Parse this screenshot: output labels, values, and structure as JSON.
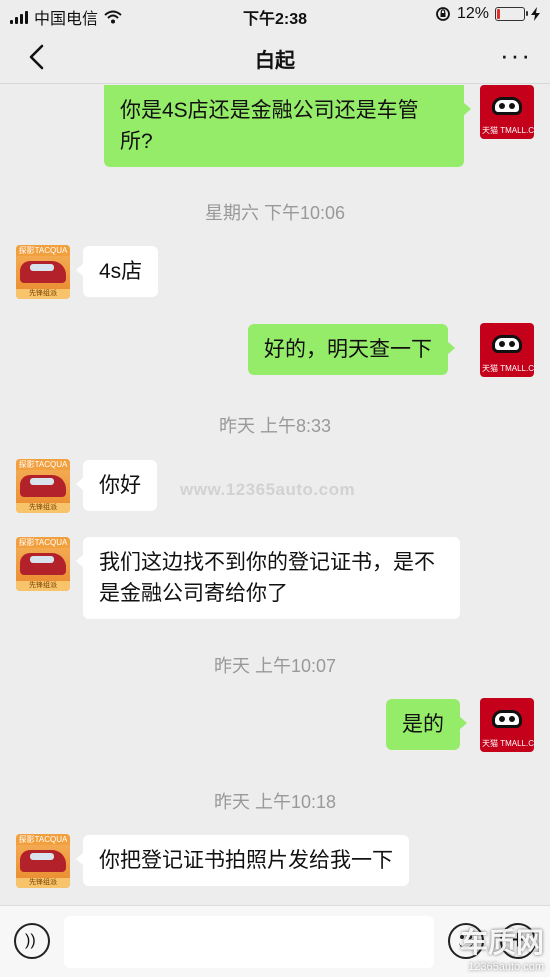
{
  "status_bar": {
    "carrier": "中国电信",
    "time": "下午2:38",
    "battery_percent": "12%",
    "battery_level": 0.12,
    "battery_color": "#e0302a"
  },
  "nav": {
    "title": "白起",
    "back_icon": "chevron-left-icon",
    "more_icon": "more-dots-icon",
    "more_glyph": "···"
  },
  "messages": [
    {
      "side": "sent",
      "text": "你是4S店还是金融公司还是车管所?",
      "avatar": "tmall"
    },
    {
      "divider": "星期六 下午10:06"
    },
    {
      "side": "recv",
      "text": "4s店",
      "avatar": "car"
    },
    {
      "side": "sent",
      "text": "好的，明天查一下",
      "avatar": "tmall"
    },
    {
      "divider": "昨天 上午8:33"
    },
    {
      "side": "recv",
      "text": "你好",
      "avatar": "car"
    },
    {
      "side": "recv",
      "text": "我们这边找不到你的登记证书，是不是金融公司寄给你了",
      "avatar": "car"
    },
    {
      "divider": "昨天 上午10:07"
    },
    {
      "side": "sent",
      "text": "是的",
      "avatar": "tmall"
    },
    {
      "divider": "昨天 上午10:18"
    },
    {
      "side": "recv",
      "text": "你把登记证书拍照片发给我一下",
      "avatar": "car"
    }
  ],
  "avatars": {
    "car_top": "探影TACQUA",
    "car_bottom": "先锋组派",
    "tmall_label": "天猫 TMALL.COM"
  },
  "watermark": "www.12365auto.com",
  "input_bar": {
    "voice_icon": "voice-icon",
    "emoji_icon": "emoji-icon",
    "plus_icon": "plus-icon",
    "plus_glyph": "+"
  },
  "corner_logo": {
    "main": "车质网",
    "url": "12365auto.com"
  },
  "colors": {
    "sent_bubble": "#95ec69",
    "recv_bubble": "#ffffff",
    "background": "#ededed"
  }
}
